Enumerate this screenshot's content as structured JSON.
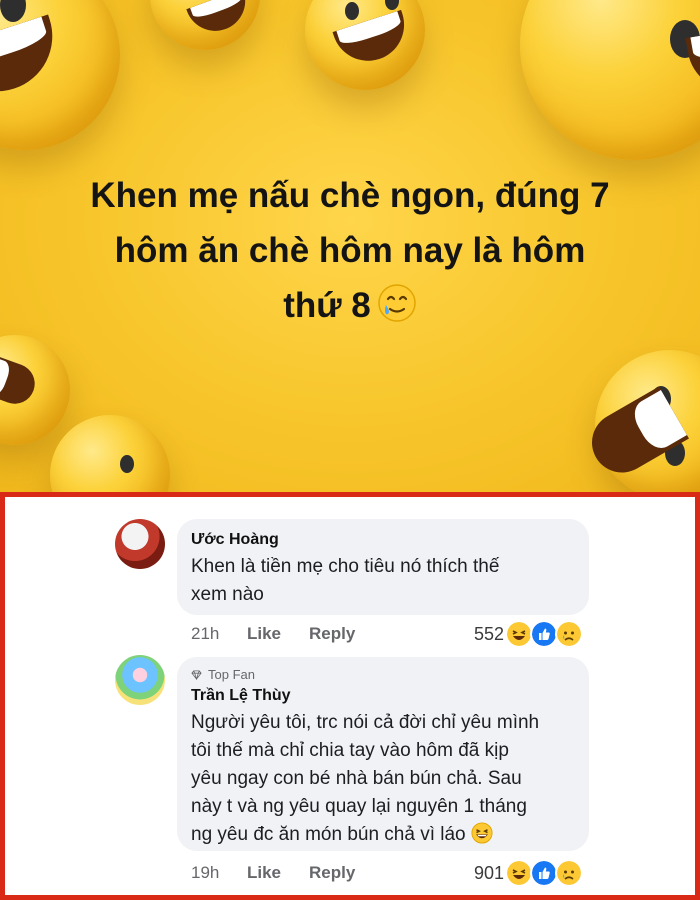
{
  "post": {
    "headline_lines": [
      "Khen mẹ nấu chè ngon, đúng 7",
      "hôm ăn chè hôm nay là hôm",
      "thứ 8"
    ],
    "headline_emoji": "smiling-face-with-tear",
    "background_color": "#f7c52a"
  },
  "comments": [
    {
      "author": "Ước Hoàng",
      "badge": "",
      "text_lines": [
        "Khen là tiền mẹ cho tiêu nó thích thế",
        "xem nào"
      ],
      "time": "21h",
      "like_label": "Like",
      "reply_label": "Reply",
      "reaction_count": "552",
      "reactions": [
        "haha",
        "like",
        "sad"
      ]
    },
    {
      "author": "Trần Lệ Thùy",
      "badge": "Top Fan",
      "text_lines": [
        "Người yêu tôi, trc nói cả đời chỉ yêu mình",
        "tôi thế mà chỉ chia tay vào hôm đã kịp",
        "yêu ngay con bé nhà bán bún chả. Sau",
        "này t và ng yêu quay lại nguyên 1 tháng",
        "ng yêu đc ăn món bún chả vì láo"
      ],
      "text_trailing_emoji": "grinning-squinting-face",
      "time": "19h",
      "like_label": "Like",
      "reply_label": "Reply",
      "reaction_count": "901",
      "reactions": [
        "haha",
        "like",
        "sad"
      ]
    }
  ],
  "colors": {
    "panel_border": "#d82a16",
    "bubble_bg": "#f0f2f5",
    "meta_text": "#65676b",
    "like_blue": "#1877f2"
  }
}
